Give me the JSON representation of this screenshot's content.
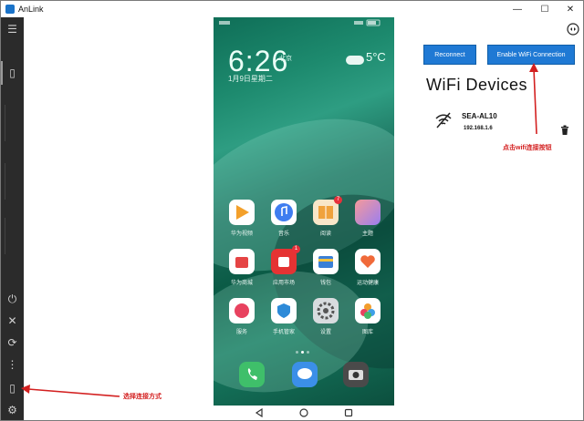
{
  "window": {
    "title": "AnLink",
    "controls": {
      "minimize": "—",
      "maximize": "☐",
      "close": "✕"
    }
  },
  "sidebar": {
    "top": [
      {
        "name": "menu-icon",
        "glyph": "☰"
      },
      {
        "name": "phone-device-icon",
        "glyph": "▯"
      }
    ],
    "bottom": [
      {
        "name": "power-icon",
        "glyph": "⏻"
      },
      {
        "name": "screen-off-icon",
        "glyph": "✕"
      },
      {
        "name": "rotate-icon",
        "glyph": "⟳"
      },
      {
        "name": "more-icon",
        "glyph": "⋮"
      },
      {
        "name": "connection-mode-icon",
        "glyph": "▯"
      },
      {
        "name": "settings-icon",
        "glyph": "⚙"
      }
    ]
  },
  "phone": {
    "clock": "6:26",
    "clock_location": "北京",
    "date": "1月9日星期二",
    "temperature": "5°C",
    "apps": [
      {
        "label": "华为视频",
        "color": "#f3a02b"
      },
      {
        "label": "音乐",
        "color": "#3f7df0"
      },
      {
        "label": "阅读",
        "color": "#f0a23c",
        "badge": "7"
      },
      {
        "label": "主题",
        "color": "#f59a9a"
      },
      {
        "label": "华为商城",
        "color": "#e54444"
      },
      {
        "label": "应用市场",
        "color": "#e53333",
        "badge": "1"
      },
      {
        "label": "钱包",
        "color": "#3a7fd6"
      },
      {
        "label": "运动健康",
        "color": "#f06a3a"
      },
      {
        "label": "服务",
        "color": "#e8425f"
      },
      {
        "label": "手机管家",
        "color": "#2d8ad8"
      },
      {
        "label": "设置",
        "color": "#7a7f85"
      },
      {
        "label": "图库",
        "color": "#f29d2c"
      }
    ],
    "dock": [
      {
        "name": "phone-app-icon",
        "color": "#3fbf6a"
      },
      {
        "name": "messages-app-icon",
        "color": "#3b8fe8"
      },
      {
        "name": "camera-app-icon",
        "color": "#4a4a4a"
      }
    ]
  },
  "actions": {
    "reconnect_label": "Reconnect",
    "enable_wifi_label": "Enable WiFi Connection"
  },
  "wifi": {
    "title": "WiFi Devices",
    "devices": [
      {
        "name": "SEA-AL10",
        "ip": "192.168.1.6"
      }
    ]
  },
  "annotations": {
    "wifi_note": "点击wifi连接按钮",
    "mode_note": "选择连接方式"
  },
  "colors": {
    "accent_button": "#1f79d4",
    "sidebar_bg": "#2b2b2b",
    "annotation": "#d32020"
  }
}
